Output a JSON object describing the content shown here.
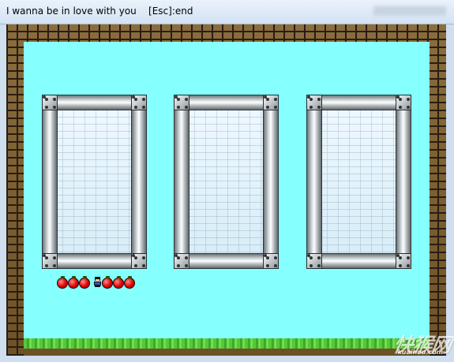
{
  "window": {
    "title": "I wanna be in love with you    [Esc]:end"
  },
  "game": {
    "background_color": "#86ffff",
    "brick_color": "#7b5d30",
    "grass_color": "#53c93a",
    "fruit_color": "#e00000",
    "window_frames": [
      "metal-window-frame",
      "metal-window-frame",
      "metal-window-frame"
    ],
    "fruit_count": 6
  },
  "watermark": {
    "brand": "快猴网",
    "url": "kuaihou.com"
  }
}
